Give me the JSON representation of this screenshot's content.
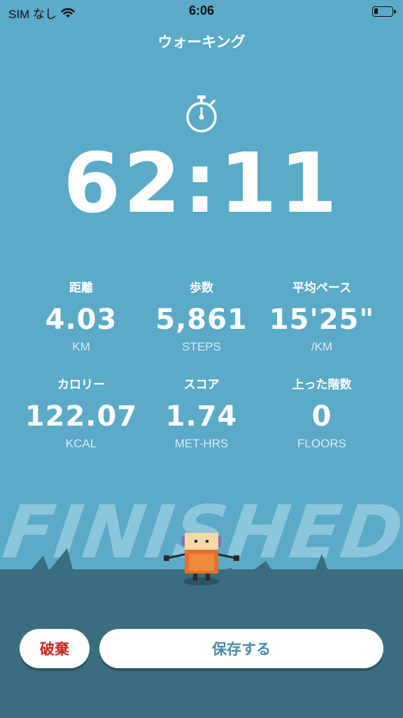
{
  "status_bar": {
    "carrier": "SIM なし",
    "time": "6:06"
  },
  "header": {
    "title": "ウォーキング"
  },
  "timer": {
    "elapsed": "62:11",
    "icon": "stopwatch-icon"
  },
  "stats": [
    {
      "label": "距離",
      "value": "4.03",
      "unit": "KM"
    },
    {
      "label": "歩数",
      "value": "5,861",
      "unit": "STEPS"
    },
    {
      "label": "平均ペース",
      "value": "15'25\"",
      "unit": "/KM"
    },
    {
      "label": "カロリー",
      "value": "122.07",
      "unit": "KCAL"
    },
    {
      "label": "スコア",
      "value": "1.74",
      "unit": "MET-HRS"
    },
    {
      "label": "上った階数",
      "value": "0",
      "unit": "FLOORS"
    }
  ],
  "banner": {
    "text": "FINISHED!!"
  },
  "actions": {
    "discard_label": "破棄",
    "save_label": "保存する"
  },
  "colors": {
    "background": "#5aaac8",
    "ground": "#3b6d80",
    "discard_text": "#c6261b",
    "save_text": "#4a8aaa"
  }
}
